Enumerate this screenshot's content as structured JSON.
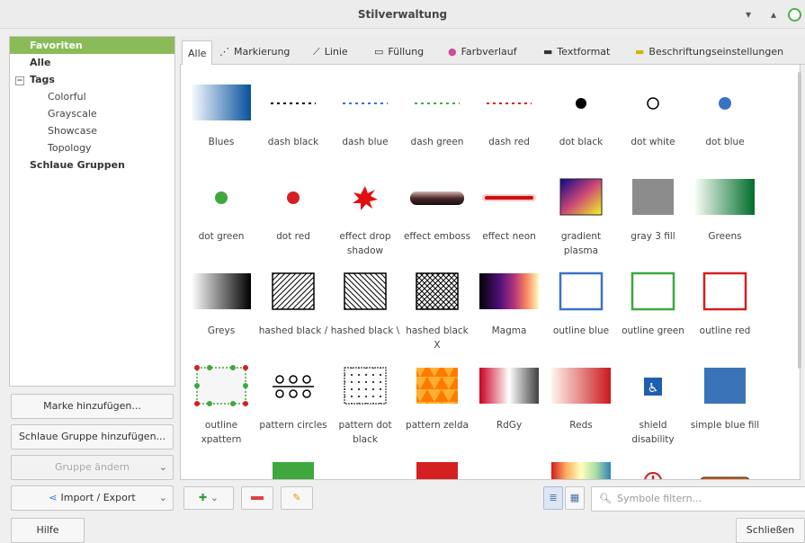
{
  "window": {
    "title": "Stilverwaltung"
  },
  "sidebar": {
    "items": [
      {
        "label": "Favoriten"
      },
      {
        "label": "Alle"
      },
      {
        "label": "Tags"
      },
      {
        "label": "Colorful"
      },
      {
        "label": "Grayscale"
      },
      {
        "label": "Showcase"
      },
      {
        "label": "Topology"
      },
      {
        "label": "Schlaue Gruppen"
      }
    ],
    "tree_expander": "−",
    "buttons": {
      "add_tag": "Marke hinzufügen...",
      "add_smart_group": "Schlaue Gruppe hinzufügen...",
      "edit_group": "Gruppe ändern",
      "import_export": "Import / Export"
    }
  },
  "tabs": [
    {
      "label": "Alle",
      "icon": "all"
    },
    {
      "label": "Markierung",
      "icon": "marker-icon"
    },
    {
      "label": "Linie",
      "icon": "line-icon"
    },
    {
      "label": "Füllung",
      "icon": "fill-icon"
    },
    {
      "label": "Farbverlauf",
      "icon": "color-ramp-icon"
    },
    {
      "label": "Textformat",
      "icon": "text-format-icon"
    },
    {
      "label": "Beschriftungseinstellungen",
      "icon": "label-settings-icon"
    }
  ],
  "symbols": [
    {
      "label": "Blues"
    },
    {
      "label": "dash  black"
    },
    {
      "label": "dash blue"
    },
    {
      "label": "dash green"
    },
    {
      "label": "dash red"
    },
    {
      "label": "dot  black"
    },
    {
      "label": "dot  white"
    },
    {
      "label": "dot blue"
    },
    {
      "label": "dot green"
    },
    {
      "label": "dot red"
    },
    {
      "label": "effect drop shadow"
    },
    {
      "label": "effect emboss"
    },
    {
      "label": "effect neon"
    },
    {
      "label": "gradient plasma"
    },
    {
      "label": "gray 3 fill"
    },
    {
      "label": "Greens"
    },
    {
      "label": "Greys"
    },
    {
      "label": "hashed black /"
    },
    {
      "label": "hashed black \\"
    },
    {
      "label": "hashed black X"
    },
    {
      "label": "Magma"
    },
    {
      "label": "outline blue"
    },
    {
      "label": "outline green"
    },
    {
      "label": "outline red"
    },
    {
      "label": "outline xpattern"
    },
    {
      "label": "pattern circles"
    },
    {
      "label": "pattern dot black"
    },
    {
      "label": "pattern zelda"
    },
    {
      "label": "RdGy"
    },
    {
      "label": "Reds"
    },
    {
      "label": "shield disability"
    },
    {
      "label": "simple blue fill"
    },
    {
      "label": ""
    },
    {
      "label": ""
    },
    {
      "label": ""
    },
    {
      "label": ""
    },
    {
      "label": ""
    },
    {
      "label": ""
    },
    {
      "label": ""
    },
    {
      "label": ""
    }
  ],
  "toolbar": {
    "add_symbol_icon": "add-icon",
    "remove_icon": "remove-icon",
    "edit_icon": "edit-icon"
  },
  "filter": {
    "placeholder": "Symbole filtern..."
  },
  "footer": {
    "help": "Hilfe",
    "close": "Schließen"
  },
  "colors": {
    "accent": "#8bbb58",
    "selection": "#8bbb58"
  }
}
